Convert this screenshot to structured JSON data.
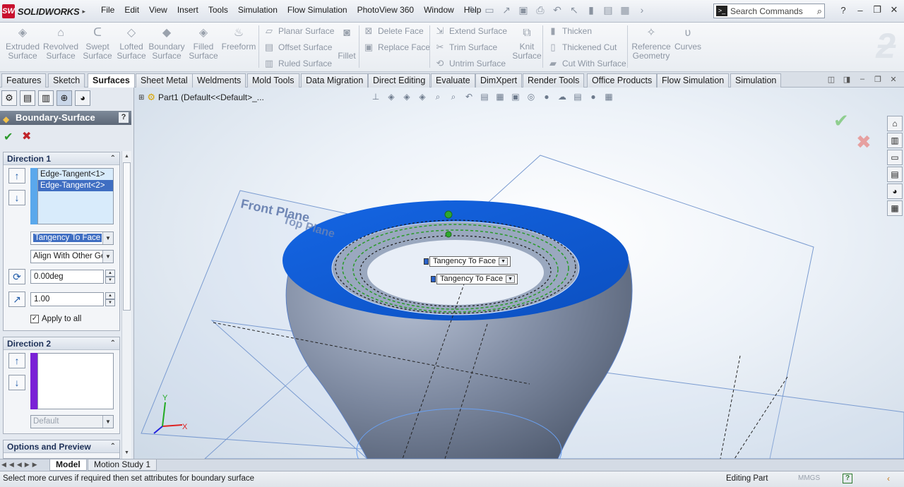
{
  "app": {
    "logo_mark": "SW",
    "logo_text": "SOLIDWORKS",
    "logo_arrow": "▸"
  },
  "menu": [
    "File",
    "Edit",
    "View",
    "Insert",
    "Tools",
    "Simulation",
    "Flow Simulation",
    "PhotoView 360",
    "Window",
    "Help"
  ],
  "search": {
    "placeholder": "Search Commands"
  },
  "ribbon": {
    "extruded_surface": "Extruded Surface",
    "revolved_surface": "Revolved Surface",
    "swept_surface": "Swept Surface",
    "lofted_surface": "Lofted Surface",
    "boundary_surface": "Boundary Surface",
    "filled_surface": "Filled Surface",
    "freeform": "Freeform",
    "planar_surface": "Planar Surface",
    "offset_surface": "Offset Surface",
    "ruled_surface": "Ruled Surface",
    "fillet": "Fillet",
    "delete_face": "Delete Face",
    "replace_face": "Replace Face",
    "extend_surface": "Extend Surface",
    "trim_surface": "Trim Surface",
    "untrim_surface": "Untrim Surface",
    "knit_surface": "Knit Surface",
    "thicken": "Thicken",
    "thickened_cut": "Thickened Cut",
    "cut_with_surface": "Cut With Surface",
    "reference_geometry": "Reference Geometry",
    "curves": "Curves"
  },
  "tabs": [
    "Features",
    "Sketch",
    "Surfaces",
    "Sheet Metal",
    "Weldments",
    "Mold Tools",
    "Data Migration",
    "Direct Editing",
    "Evaluate",
    "DimXpert",
    "Render Tools",
    "Office Products",
    "Flow Simulation",
    "Simulation"
  ],
  "active_tab": "Surfaces",
  "property_manager": {
    "title": "Boundary-Surface",
    "help": "?",
    "direction1": {
      "title": "Direction 1",
      "items": [
        "Edge-Tangent<1>",
        "Edge-Tangent<2>"
      ],
      "tangency": "Tangency To Face",
      "alignment": "Align With Other Ge",
      "angle": "0.00deg",
      "tangent_length": "1.00",
      "apply_to_all": "Apply to all"
    },
    "direction2": {
      "title": "Direction 2",
      "tangency": "Default"
    },
    "options_title": "Options and Preview"
  },
  "viewport": {
    "tree_label": "Part1  (Default<<Default>_...",
    "front_plane": "Front Plane",
    "top_plane": "Top Plane",
    "callout1": "Tangency To Face",
    "callout2": "Tangency To Face",
    "axis_x": "X",
    "axis_y": "Y"
  },
  "bottom_tabs": [
    "Model",
    "Motion Study 1"
  ],
  "status": {
    "message": "Select more curves if required then set attributes for boundary surface",
    "mode": "Editing Part",
    "units": "MMGS"
  },
  "colors": {
    "accent": "#3f6ec2",
    "surface_blue": "#1a6fe0",
    "direction2_bar": "#7a22d6"
  }
}
